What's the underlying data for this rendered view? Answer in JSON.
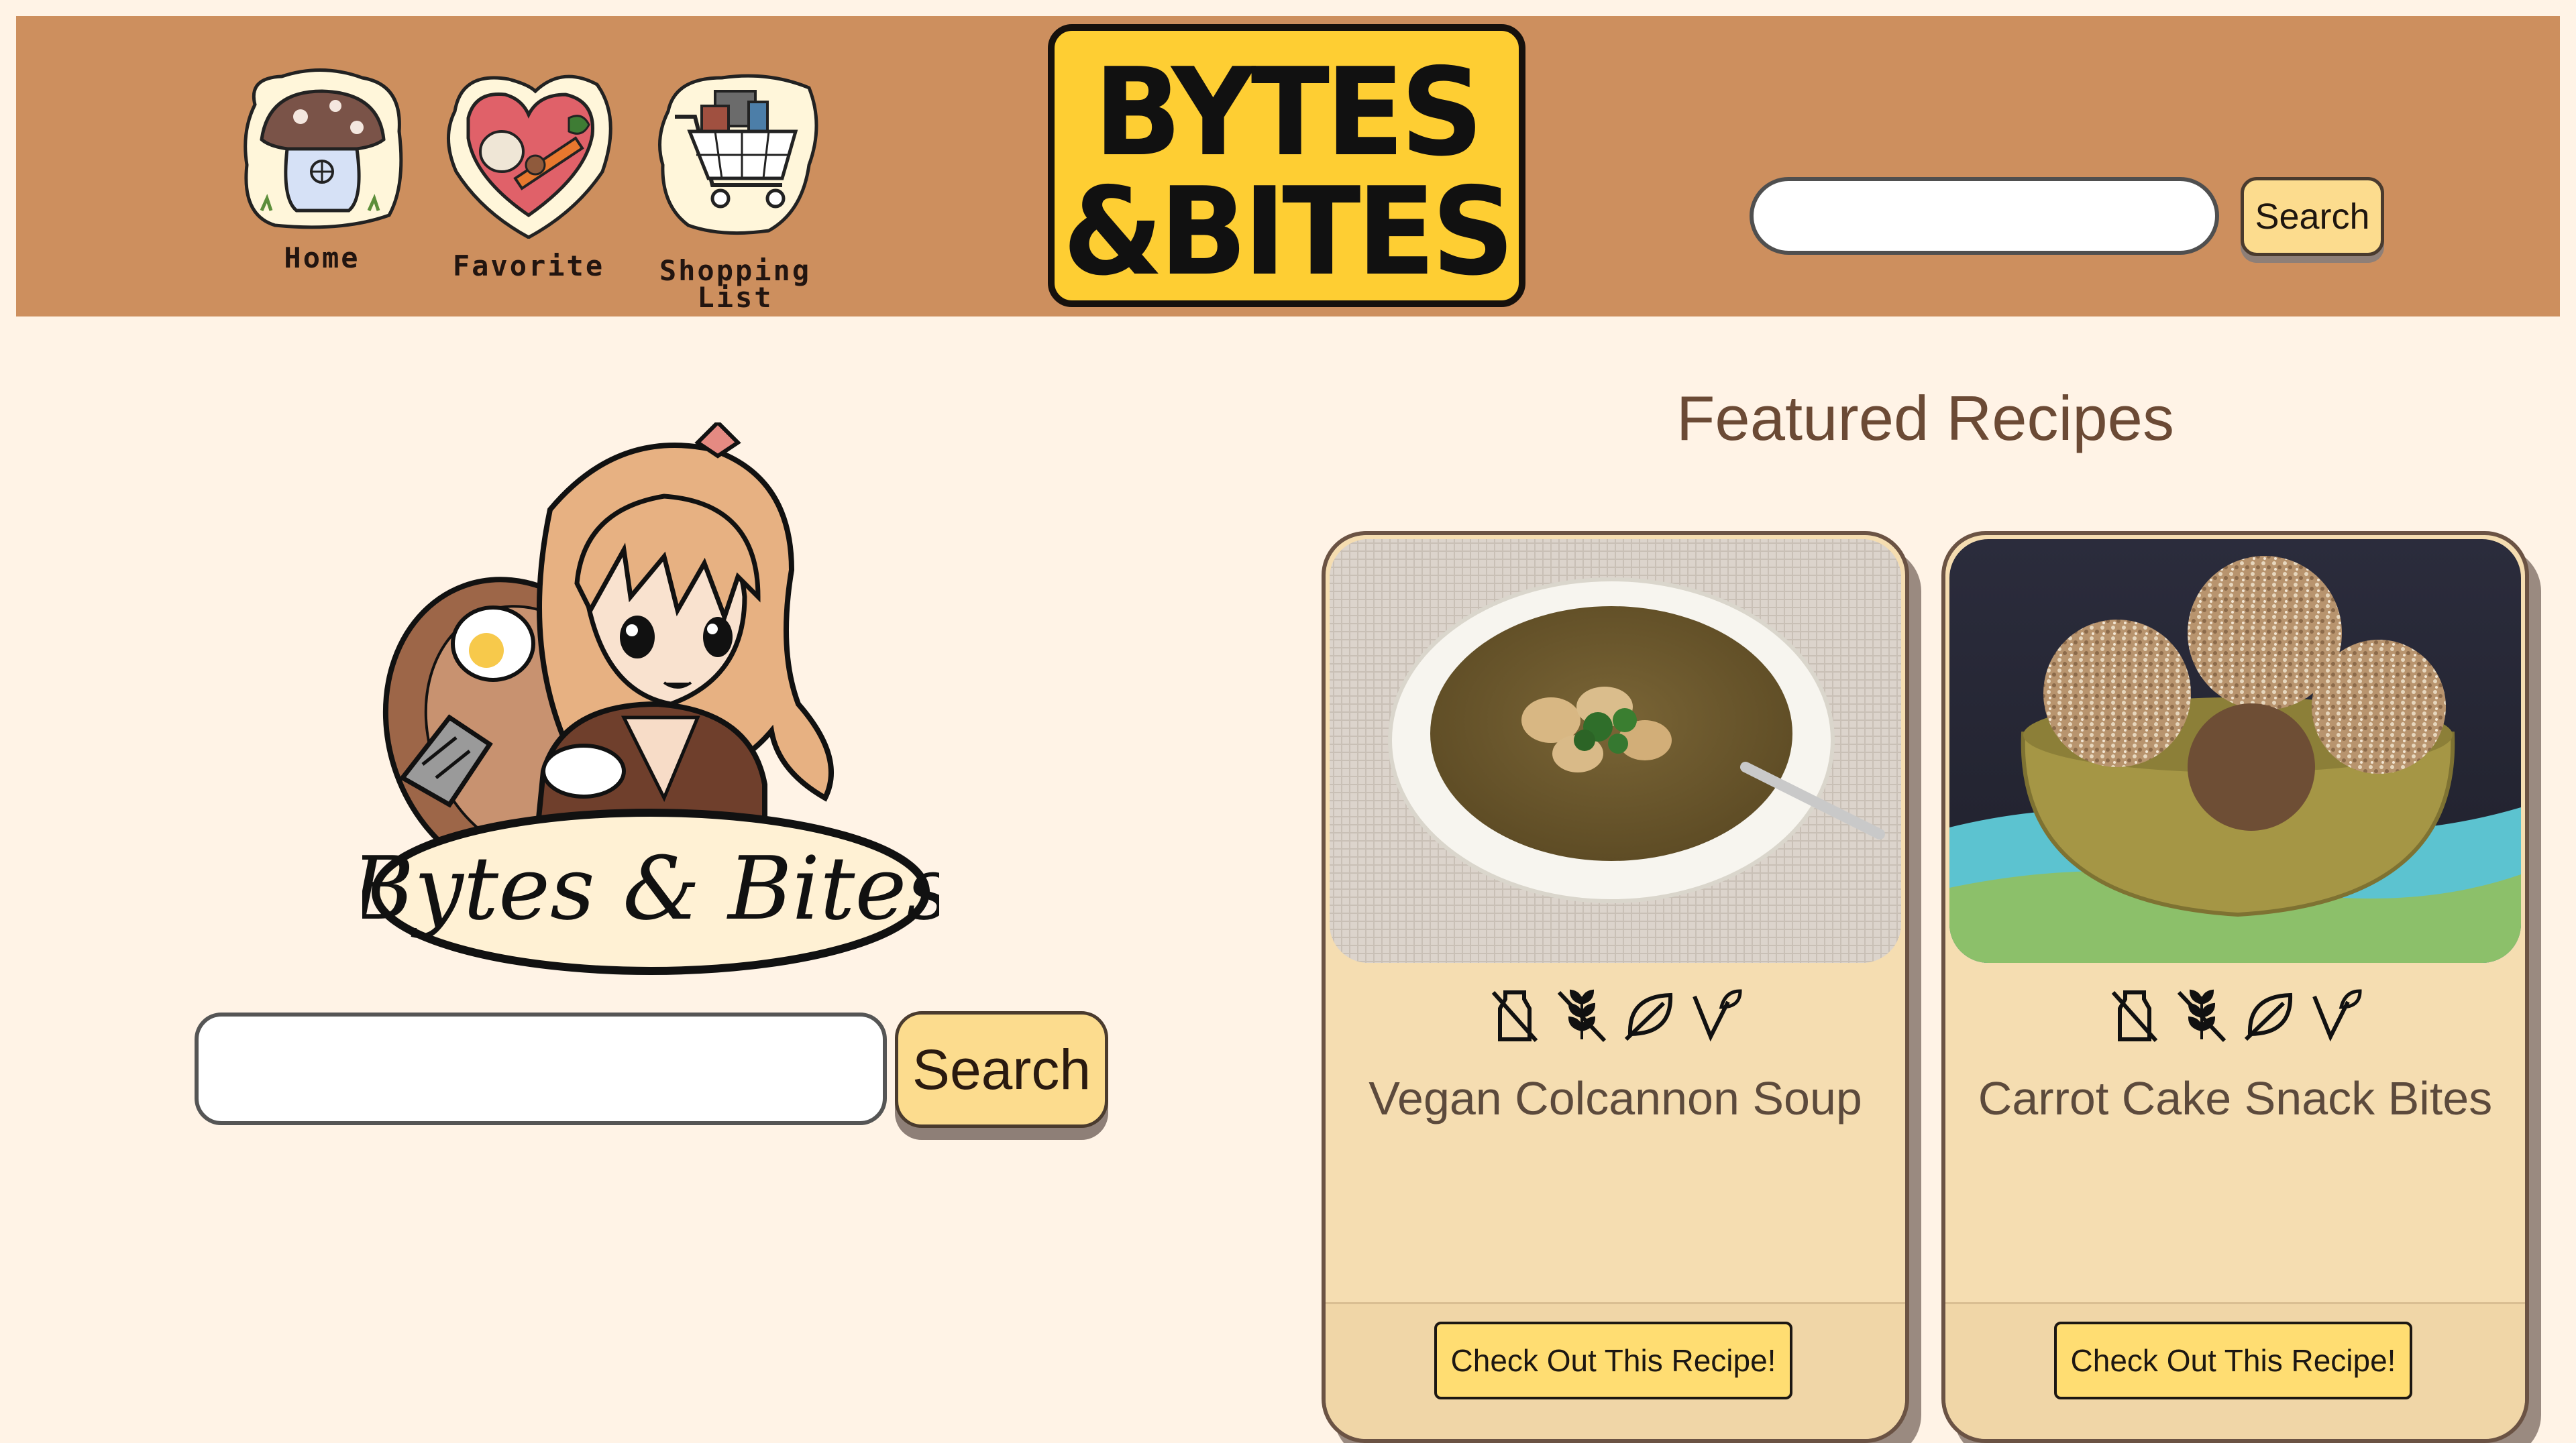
{
  "nav": {
    "items": [
      {
        "label": "Home",
        "icon": "mushroom-house-icon"
      },
      {
        "label": "Favorite",
        "icon": "heart-vegetables-icon"
      },
      {
        "label": "Shopping\nList",
        "icon": "shopping-cart-icon"
      }
    ]
  },
  "logo": {
    "line1": "BYTES",
    "line2": "&BITES"
  },
  "header_search": {
    "value": "",
    "placeholder": "",
    "button_label": "Search"
  },
  "hero": {
    "mascot_logo_text": "Bytes & Bites"
  },
  "main_search": {
    "value": "",
    "placeholder": "",
    "button_label": "Search"
  },
  "featured": {
    "title": "Featured Recipes",
    "cards": [
      {
        "title": "Vegan Colcannon Soup",
        "button_label": "Check Out This Recipe!",
        "photo": "bowl-of-soup-photo",
        "diet_icons": [
          "no-dairy-icon",
          "no-gluten-icon",
          "vegetarian-leaf-icon",
          "vegan-icon"
        ]
      },
      {
        "title": "Carrot Cake Snack Bites",
        "button_label": "Check Out This Recipe!",
        "photo": "snack-bites-bowl-photo",
        "diet_icons": [
          "no-dairy-icon",
          "no-gluten-icon",
          "vegetarian-leaf-icon",
          "vegan-icon"
        ]
      }
    ]
  },
  "colors": {
    "page_bg": "#FFF3E6",
    "header_bg": "#CD8F5E",
    "logo_yellow": "#FECE33",
    "button_yellow": "#FCDC8E",
    "card_bg": "#F5DDB1",
    "text_brown": "#6B4A35"
  }
}
